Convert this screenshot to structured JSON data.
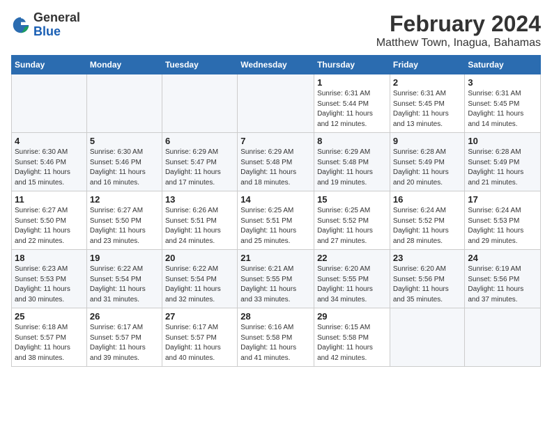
{
  "header": {
    "logo_line1": "General",
    "logo_line2": "Blue",
    "title": "February 2024",
    "subtitle": "Matthew Town, Inagua, Bahamas"
  },
  "weekdays": [
    "Sunday",
    "Monday",
    "Tuesday",
    "Wednesday",
    "Thursday",
    "Friday",
    "Saturday"
  ],
  "weeks": [
    [
      {
        "day": "",
        "info": ""
      },
      {
        "day": "",
        "info": ""
      },
      {
        "day": "",
        "info": ""
      },
      {
        "day": "",
        "info": ""
      },
      {
        "day": "1",
        "info": "Sunrise: 6:31 AM\nSunset: 5:44 PM\nDaylight: 11 hours\nand 12 minutes."
      },
      {
        "day": "2",
        "info": "Sunrise: 6:31 AM\nSunset: 5:45 PM\nDaylight: 11 hours\nand 13 minutes."
      },
      {
        "day": "3",
        "info": "Sunrise: 6:31 AM\nSunset: 5:45 PM\nDaylight: 11 hours\nand 14 minutes."
      }
    ],
    [
      {
        "day": "4",
        "info": "Sunrise: 6:30 AM\nSunset: 5:46 PM\nDaylight: 11 hours\nand 15 minutes."
      },
      {
        "day": "5",
        "info": "Sunrise: 6:30 AM\nSunset: 5:46 PM\nDaylight: 11 hours\nand 16 minutes."
      },
      {
        "day": "6",
        "info": "Sunrise: 6:29 AM\nSunset: 5:47 PM\nDaylight: 11 hours\nand 17 minutes."
      },
      {
        "day": "7",
        "info": "Sunrise: 6:29 AM\nSunset: 5:48 PM\nDaylight: 11 hours\nand 18 minutes."
      },
      {
        "day": "8",
        "info": "Sunrise: 6:29 AM\nSunset: 5:48 PM\nDaylight: 11 hours\nand 19 minutes."
      },
      {
        "day": "9",
        "info": "Sunrise: 6:28 AM\nSunset: 5:49 PM\nDaylight: 11 hours\nand 20 minutes."
      },
      {
        "day": "10",
        "info": "Sunrise: 6:28 AM\nSunset: 5:49 PM\nDaylight: 11 hours\nand 21 minutes."
      }
    ],
    [
      {
        "day": "11",
        "info": "Sunrise: 6:27 AM\nSunset: 5:50 PM\nDaylight: 11 hours\nand 22 minutes."
      },
      {
        "day": "12",
        "info": "Sunrise: 6:27 AM\nSunset: 5:50 PM\nDaylight: 11 hours\nand 23 minutes."
      },
      {
        "day": "13",
        "info": "Sunrise: 6:26 AM\nSunset: 5:51 PM\nDaylight: 11 hours\nand 24 minutes."
      },
      {
        "day": "14",
        "info": "Sunrise: 6:25 AM\nSunset: 5:51 PM\nDaylight: 11 hours\nand 25 minutes."
      },
      {
        "day": "15",
        "info": "Sunrise: 6:25 AM\nSunset: 5:52 PM\nDaylight: 11 hours\nand 27 minutes."
      },
      {
        "day": "16",
        "info": "Sunrise: 6:24 AM\nSunset: 5:52 PM\nDaylight: 11 hours\nand 28 minutes."
      },
      {
        "day": "17",
        "info": "Sunrise: 6:24 AM\nSunset: 5:53 PM\nDaylight: 11 hours\nand 29 minutes."
      }
    ],
    [
      {
        "day": "18",
        "info": "Sunrise: 6:23 AM\nSunset: 5:53 PM\nDaylight: 11 hours\nand 30 minutes."
      },
      {
        "day": "19",
        "info": "Sunrise: 6:22 AM\nSunset: 5:54 PM\nDaylight: 11 hours\nand 31 minutes."
      },
      {
        "day": "20",
        "info": "Sunrise: 6:22 AM\nSunset: 5:54 PM\nDaylight: 11 hours\nand 32 minutes."
      },
      {
        "day": "21",
        "info": "Sunrise: 6:21 AM\nSunset: 5:55 PM\nDaylight: 11 hours\nand 33 minutes."
      },
      {
        "day": "22",
        "info": "Sunrise: 6:20 AM\nSunset: 5:55 PM\nDaylight: 11 hours\nand 34 minutes."
      },
      {
        "day": "23",
        "info": "Sunrise: 6:20 AM\nSunset: 5:56 PM\nDaylight: 11 hours\nand 35 minutes."
      },
      {
        "day": "24",
        "info": "Sunrise: 6:19 AM\nSunset: 5:56 PM\nDaylight: 11 hours\nand 37 minutes."
      }
    ],
    [
      {
        "day": "25",
        "info": "Sunrise: 6:18 AM\nSunset: 5:57 PM\nDaylight: 11 hours\nand 38 minutes."
      },
      {
        "day": "26",
        "info": "Sunrise: 6:17 AM\nSunset: 5:57 PM\nDaylight: 11 hours\nand 39 minutes."
      },
      {
        "day": "27",
        "info": "Sunrise: 6:17 AM\nSunset: 5:57 PM\nDaylight: 11 hours\nand 40 minutes."
      },
      {
        "day": "28",
        "info": "Sunrise: 6:16 AM\nSunset: 5:58 PM\nDaylight: 11 hours\nand 41 minutes."
      },
      {
        "day": "29",
        "info": "Sunrise: 6:15 AM\nSunset: 5:58 PM\nDaylight: 11 hours\nand 42 minutes."
      },
      {
        "day": "",
        "info": ""
      },
      {
        "day": "",
        "info": ""
      }
    ]
  ]
}
